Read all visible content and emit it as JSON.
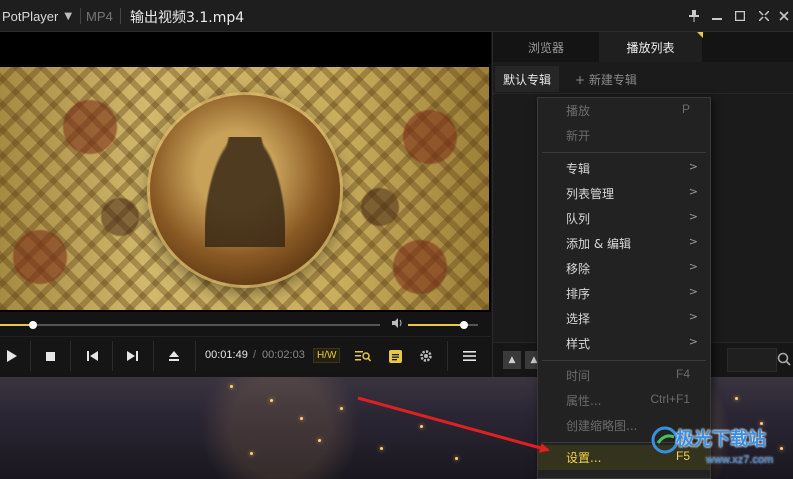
{
  "titlebar": {
    "app_name": "PotPlayer",
    "format": "MP4",
    "file_title": "输出视频3.1.mp4"
  },
  "icons": {
    "app_menu": "chevron-down-icon",
    "pin": "pin-icon",
    "minimize": "minimize-icon",
    "maximize": "maximize-icon",
    "fullscreen": "fullscreen-icon",
    "close": "close-icon"
  },
  "playback": {
    "time_current": "00:01:49",
    "time_separator": "/",
    "time_total": "00:02:03",
    "hw_badge": "H/W",
    "progress_fraction": 0.087,
    "volume_fraction": 0.8
  },
  "colors": {
    "accent": "#e8c845",
    "menu_highlight": "#f3d54a",
    "arrow": "#e02020",
    "watermark_blue": "#3b8fe0"
  },
  "playlist_panel": {
    "tabs": [
      {
        "label": "浏览器",
        "active": false
      },
      {
        "label": "播放列表",
        "active": true
      }
    ],
    "album_default": "默认专辑",
    "album_new": "+ 新建专辑"
  },
  "context_menu": {
    "items": [
      {
        "label": "播放",
        "shortcut": "P",
        "enabled": false,
        "submenu": false
      },
      {
        "label": "新开",
        "shortcut": "",
        "enabled": false,
        "submenu": false
      },
      {
        "label": "专辑",
        "shortcut": "",
        "enabled": true,
        "submenu": true
      },
      {
        "label": "列表管理",
        "shortcut": "",
        "enabled": true,
        "submenu": true
      },
      {
        "label": "队列",
        "shortcut": "",
        "enabled": true,
        "submenu": true
      },
      {
        "label": "添加 & 编辑",
        "shortcut": "",
        "enabled": true,
        "submenu": true
      },
      {
        "label": "移除",
        "shortcut": "",
        "enabled": true,
        "submenu": true
      },
      {
        "label": "排序",
        "shortcut": "",
        "enabled": true,
        "submenu": true
      },
      {
        "label": "选择",
        "shortcut": "",
        "enabled": true,
        "submenu": true
      },
      {
        "label": "样式",
        "shortcut": "",
        "enabled": true,
        "submenu": true
      },
      {
        "label": "时间",
        "shortcut": "F4",
        "enabled": false,
        "submenu": false
      },
      {
        "label": "属性...",
        "shortcut": "Ctrl+F1",
        "enabled": false,
        "submenu": false
      },
      {
        "label": "创建缩略图...",
        "shortcut": "",
        "enabled": false,
        "submenu": false
      },
      {
        "label": "设置...",
        "shortcut": "F5",
        "enabled": true,
        "submenu": false,
        "highlighted": true
      }
    ]
  },
  "watermark": {
    "site_name": "极光下载站",
    "site_url": "www.xz7.com"
  }
}
